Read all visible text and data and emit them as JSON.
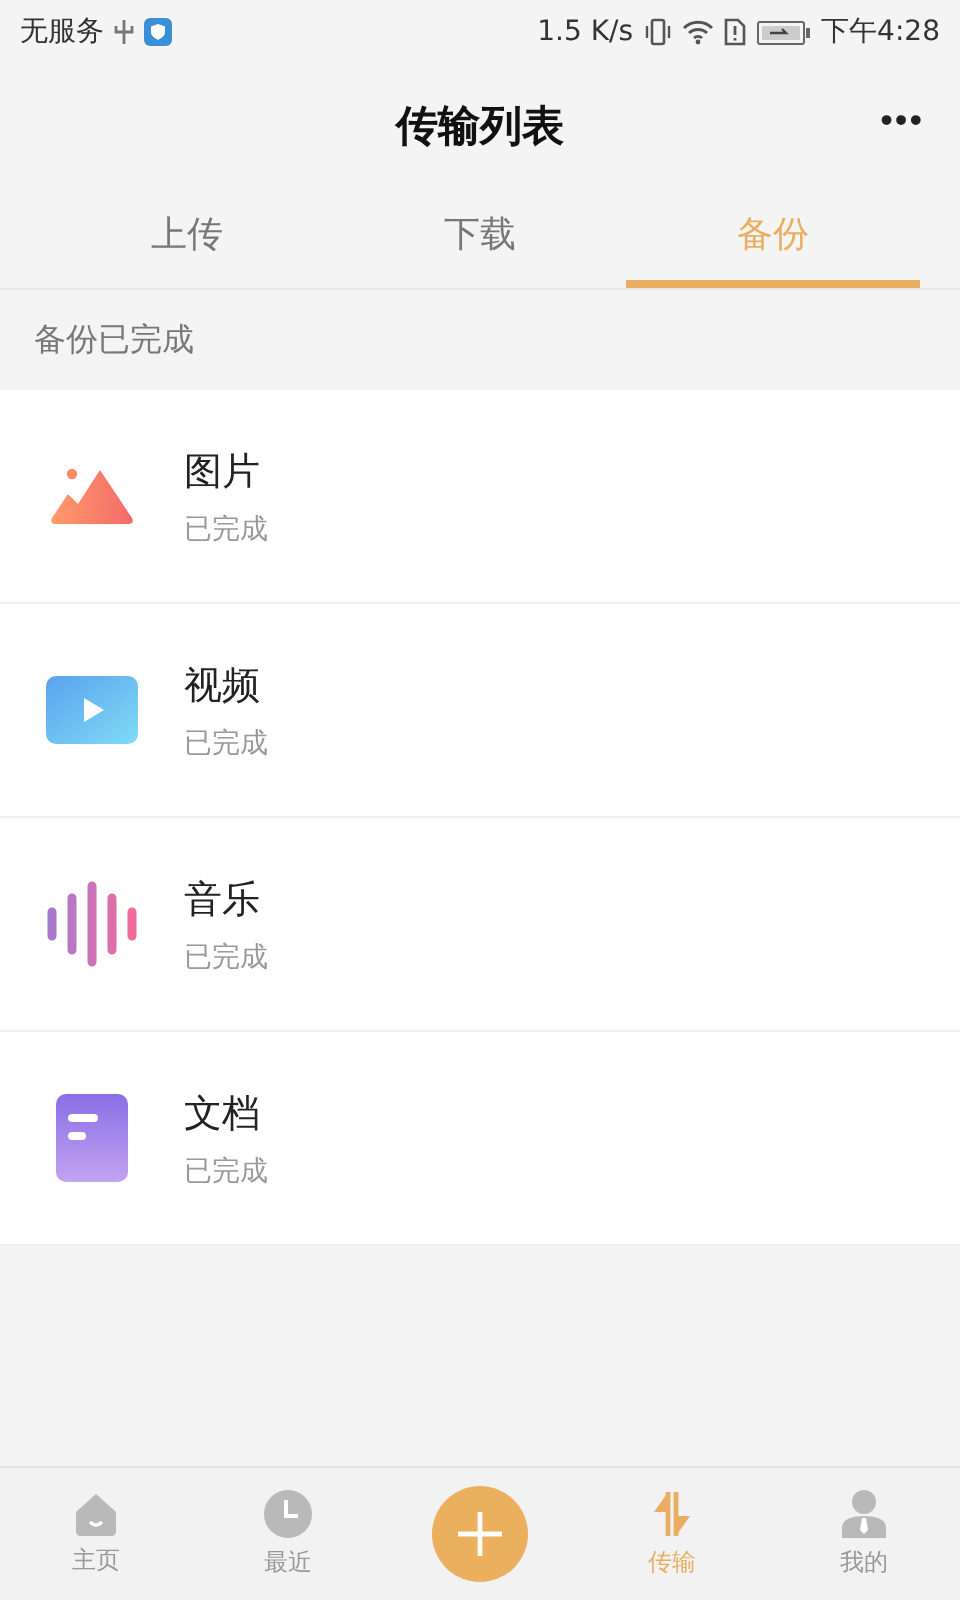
{
  "status_bar": {
    "carrier": "无服务",
    "speed": "1.5 K/s",
    "time": "下午4:28"
  },
  "header": {
    "title": "传输列表",
    "more": "•••"
  },
  "tabs": [
    {
      "label": "上传",
      "selected": false
    },
    {
      "label": "下载",
      "selected": false
    },
    {
      "label": "备份",
      "selected": true
    }
  ],
  "section": {
    "title": "备份已完成"
  },
  "items": [
    {
      "kind": "image",
      "name": "图片",
      "status": "已完成"
    },
    {
      "kind": "video",
      "name": "视频",
      "status": "已完成"
    },
    {
      "kind": "music",
      "name": "音乐",
      "status": "已完成"
    },
    {
      "kind": "document",
      "name": "文档",
      "status": "已完成"
    }
  ],
  "bottom_nav": [
    {
      "kind": "home",
      "label": "主页",
      "selected": false
    },
    {
      "kind": "recent",
      "label": "最近",
      "selected": false
    },
    {
      "kind": "add"
    },
    {
      "kind": "transfer",
      "label": "传输",
      "selected": true
    },
    {
      "kind": "me",
      "label": "我的",
      "selected": false
    }
  ]
}
